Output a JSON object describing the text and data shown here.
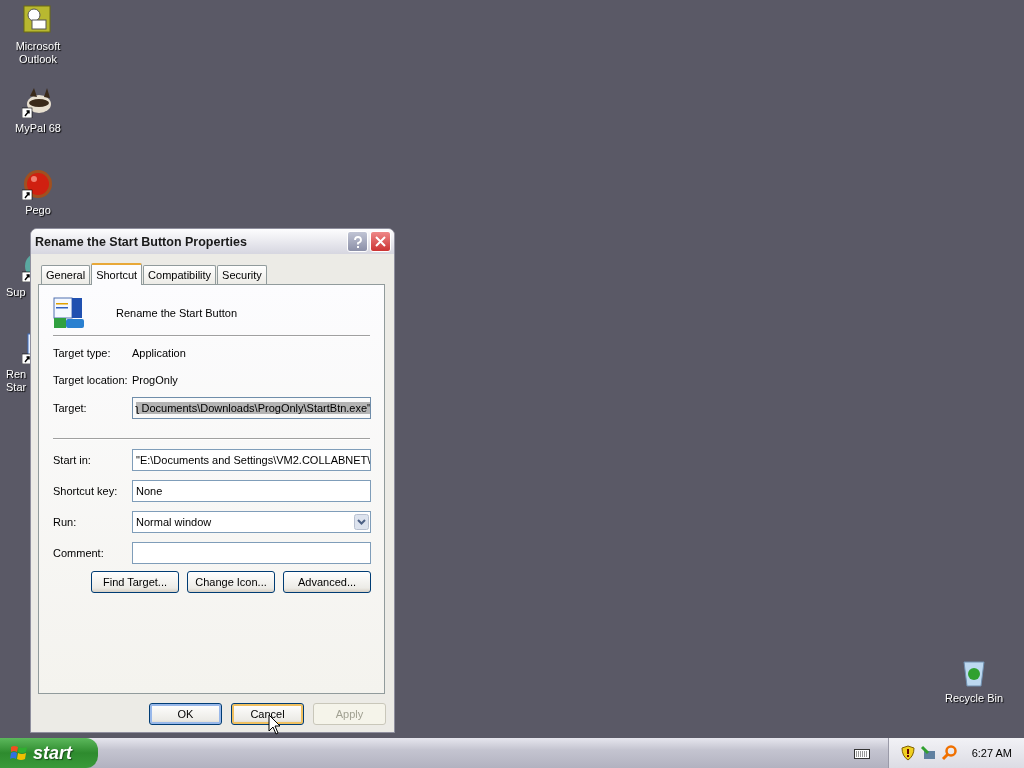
{
  "desktop_icons": [
    {
      "lines": [
        "Microsoft",
        "Outlook"
      ],
      "shortcut": false
    },
    {
      "lines": [
        "MyPal 68"
      ],
      "shortcut": true
    },
    {
      "lines": [
        "Pego"
      ],
      "shortcut": true
    },
    {
      "lines": [
        "Sup"
      ],
      "shortcut": true
    },
    {
      "lines": [
        "Ren",
        "Star"
      ],
      "shortcut": true
    },
    {
      "lines": [
        "Recycle Bin"
      ],
      "shortcut": false
    }
  ],
  "window": {
    "title": "Rename the Start Button Properties"
  },
  "tabs": [
    {
      "label": "General",
      "selected": false
    },
    {
      "label": "Shortcut",
      "selected": true
    },
    {
      "label": "Compatibility",
      "selected": false
    },
    {
      "label": "Security",
      "selected": false
    }
  ],
  "header": {
    "name": "Rename the Start Button"
  },
  "fields": [
    {
      "kind": "static",
      "label": "Target type:",
      "value": "Application"
    },
    {
      "kind": "static",
      "label": "Target location:",
      "value": "ProgOnly"
    },
    {
      "kind": "input",
      "label": "Target:",
      "value": "ʅ Documents\\Downloads\\ProgOnly\\StartBtn.exe\"",
      "selected": true
    },
    {
      "kind": "separator"
    },
    {
      "kind": "input",
      "label": "Start in:",
      "value": "\"E:\\Documents and Settings\\VM2.COLLABNET\\",
      "selected": false
    },
    {
      "kind": "input",
      "label": "Shortcut key:",
      "value": "None",
      "selected": false
    },
    {
      "kind": "dropdown",
      "label": "Run:",
      "value": "Normal window"
    },
    {
      "kind": "input",
      "label": "Comment:"
    }
  ],
  "actions": [
    "Find Target...",
    "Change Icon...",
    "Advanced..."
  ],
  "buttons": [
    {
      "label": "OK",
      "default": true,
      "focused": false,
      "disabled": false
    },
    {
      "label": "Cancel",
      "default": false,
      "focused": true,
      "disabled": false
    },
    {
      "label": "Apply",
      "default": false,
      "focused": false,
      "disabled": true
    }
  ],
  "taskbar": {
    "start": "start",
    "clock": "6:27 AM"
  }
}
